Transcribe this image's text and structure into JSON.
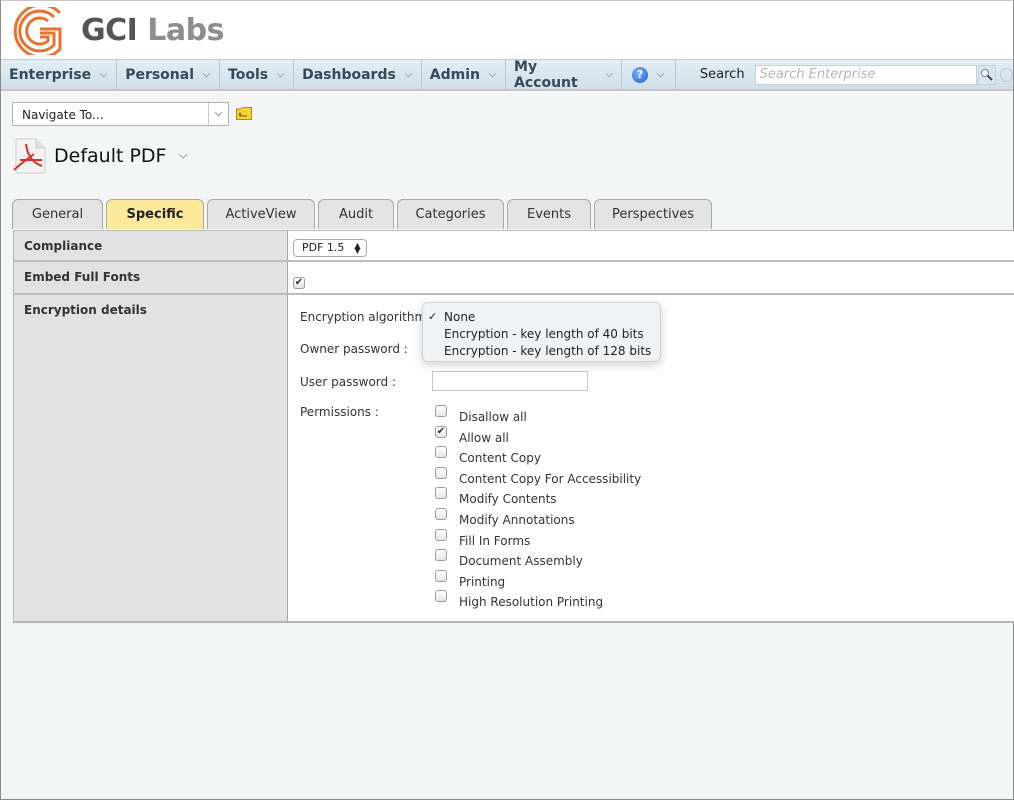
{
  "brand": {
    "name_primary": "GCI",
    "name_secondary": "Labs",
    "accent": "#e8722f"
  },
  "navbar": {
    "items": [
      {
        "label": "Enterprise"
      },
      {
        "label": "Personal"
      },
      {
        "label": "Tools"
      },
      {
        "label": "Dashboards"
      },
      {
        "label": "Admin"
      },
      {
        "label": "My Account"
      }
    ],
    "help_glyph": "?",
    "search_label": "Search",
    "search_placeholder": "Search Enterprise"
  },
  "navigate": {
    "value": "Navigate To..."
  },
  "document": {
    "title": "Default PDF"
  },
  "tabs": [
    {
      "label": "General",
      "active": false
    },
    {
      "label": "Specific",
      "active": true
    },
    {
      "label": "ActiveView",
      "active": false
    },
    {
      "label": "Audit",
      "active": false
    },
    {
      "label": "Categories",
      "active": false
    },
    {
      "label": "Events",
      "active": false
    },
    {
      "label": "Perspectives",
      "active": false
    }
  ],
  "properties": {
    "compliance": {
      "label": "Compliance",
      "value": "PDF 1.5"
    },
    "embed_fonts": {
      "label": "Embed Full Fonts",
      "checked": true,
      "check_glyph": "✔"
    },
    "encryption": {
      "label": "Encryption details",
      "algorithm_label": "Encryption algorithm :",
      "owner_password_label": "Owner password :",
      "user_password_label": "User password :",
      "permissions_label": "Permissions :",
      "algorithm_options": [
        {
          "label": "None",
          "selected": true,
          "check": "✓"
        },
        {
          "label": "Encryption - key length of 40 bits",
          "selected": false,
          "check": ""
        },
        {
          "label": "Encryption - key length of 128 bits",
          "selected": false,
          "check": ""
        }
      ],
      "permissions": [
        {
          "label": "Disallow all",
          "checked": false,
          "mark": ""
        },
        {
          "label": "Allow all",
          "checked": true,
          "mark": "✔"
        },
        {
          "label": "Content Copy",
          "checked": false,
          "mark": ""
        },
        {
          "label": "Content Copy For Accessibility",
          "checked": false,
          "mark": ""
        },
        {
          "label": "Modify Contents",
          "checked": false,
          "mark": ""
        },
        {
          "label": "Modify Annotations",
          "checked": false,
          "mark": ""
        },
        {
          "label": "Fill In Forms",
          "checked": false,
          "mark": ""
        },
        {
          "label": "Document Assembly",
          "checked": false,
          "mark": ""
        },
        {
          "label": "Printing",
          "checked": false,
          "mark": ""
        },
        {
          "label": "High Resolution Printing",
          "checked": false,
          "mark": ""
        }
      ]
    }
  }
}
